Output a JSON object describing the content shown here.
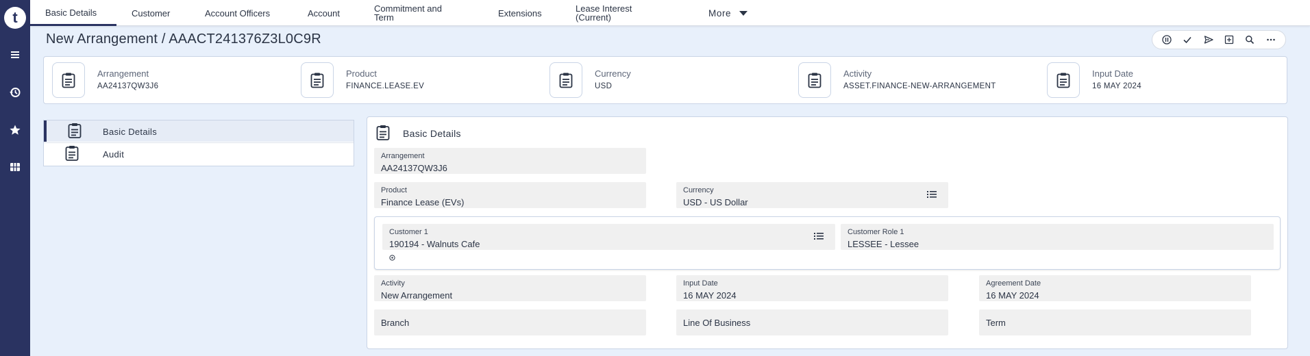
{
  "app": {
    "logo_letter": "t"
  },
  "rail": {
    "icons": [
      "menu-icon",
      "history-icon",
      "star-icon",
      "apps-grid-icon"
    ]
  },
  "nav": {
    "tabs": [
      {
        "label": "Basic Details",
        "active": true
      },
      {
        "label": "Customer"
      },
      {
        "label": "Account Officers"
      },
      {
        "label": "Account"
      },
      {
        "label_line1": "Commitment and",
        "label_line2": "Term"
      },
      {
        "label": "Extensions"
      },
      {
        "label_line1": "Lease Interest",
        "label_line2": "(Current)"
      },
      {
        "label": "More"
      }
    ]
  },
  "page": {
    "title": "New Arrangement / AAACT241376Z3L0C9R"
  },
  "toolbar": {
    "icons": [
      "hold-icon",
      "validate-check-icon",
      "commit-send-icon",
      "add-box-icon",
      "search-icon",
      "more-horizontal-icon"
    ]
  },
  "summary": [
    {
      "label": "Arrangement",
      "value": "AA24137QW3J6"
    },
    {
      "label": "Product",
      "value": "FINANCE.LEASE.EV"
    },
    {
      "label": "Currency",
      "value": "USD"
    },
    {
      "label": "Activity",
      "value": "ASSET.FINANCE-NEW-ARRANGEMENT"
    },
    {
      "label": "Input Date",
      "value": "16 MAY 2024"
    }
  ],
  "sections": [
    {
      "label": "Basic Details",
      "active": true
    },
    {
      "label": "Audit"
    }
  ],
  "form": {
    "title": "Basic Details",
    "arrangement": {
      "label": "Arrangement",
      "value": "AA24137QW3J6"
    },
    "product": {
      "label": "Product",
      "value": "Finance Lease (EVs)"
    },
    "currency": {
      "label": "Currency",
      "value": "USD - US Dollar"
    },
    "customer1": {
      "label": "Customer 1",
      "value": "190194 - Walnuts Cafe"
    },
    "customer_role1": {
      "label": "Customer Role 1",
      "value": "LESSEE - Lessee"
    },
    "activity": {
      "label": "Activity",
      "value": "New Arrangement"
    },
    "input_date": {
      "label": "Input Date",
      "value": "16 MAY 2024"
    },
    "agreement_date": {
      "label": "Agreement Date",
      "value": "16 MAY 2024"
    },
    "branch": {
      "label": "Branch"
    },
    "line_of_business": {
      "label": "Line Of Business"
    },
    "term": {
      "label": "Term"
    }
  }
}
